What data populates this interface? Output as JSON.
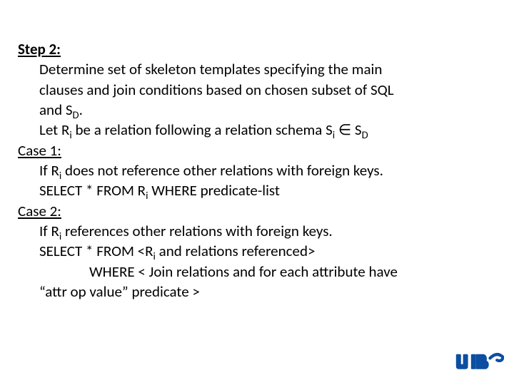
{
  "step": {
    "heading": "Step 2:",
    "line1a": "Determine set of skeleton templates specifying the main",
    "line1b": "clauses and join conditions based on chosen subset of SQL",
    "line1c_pre": "and S",
    "line1c_sub": "D",
    "line1c_post": ".",
    "line2_pre": "Let R",
    "line2_sub1": "i",
    "line2_mid": " be a relation following a relation schema S",
    "line2_sub2": "i",
    "line2_mem": " ∈ S",
    "line2_sub3": "D"
  },
  "case1": {
    "heading": "Case 1:",
    "l1_pre": "If R",
    "l1_sub": "i",
    "l1_post": " does not reference other relations with foreign keys.",
    "l2_pre": " SELECT * FROM R",
    "l2_sub": "i",
    "l2_post": " WHERE predicate-list"
  },
  "case2": {
    "heading": "Case 2:",
    "l1_pre": "If R",
    "l1_sub": "i",
    "l1_post": " references other relations with foreign keys.",
    "l2_pre": "SELECT * FROM <R",
    "l2_sub": "i",
    "l2_post": " and relations referenced>",
    "l3": "WHERE  < Join relations and for each attribute have",
    "l4": "“attr op value” predicate >"
  },
  "brand": {
    "name": "ub-logo"
  }
}
